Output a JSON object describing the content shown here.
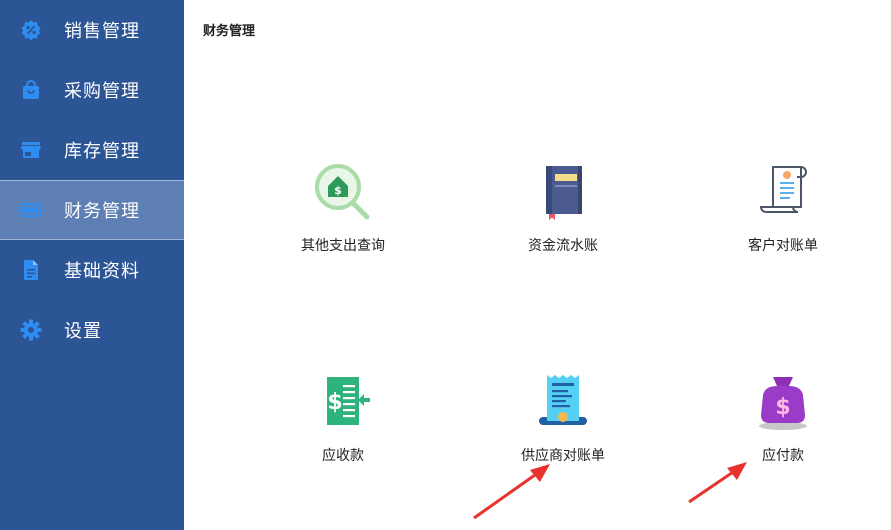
{
  "sidebar": {
    "items": [
      {
        "label": "销售管理",
        "icon": "percent-badge-icon"
      },
      {
        "label": "采购管理",
        "icon": "shopping-bag-icon"
      },
      {
        "label": "库存管理",
        "icon": "store-icon"
      },
      {
        "label": "财务管理",
        "icon": "money-icon",
        "active": true
      },
      {
        "label": "基础资料",
        "icon": "document-icon"
      },
      {
        "label": "设置",
        "icon": "gear-icon"
      }
    ],
    "background_color": "#2c5596",
    "active_color": "#5e7fb3",
    "icon_color": "#2f8cf0"
  },
  "main": {
    "title": "财务管理",
    "tiles": [
      {
        "label": "其他支出查询",
        "icon": "magnifier-house-money-icon"
      },
      {
        "label": "资金流水账",
        "icon": "ledger-book-icon"
      },
      {
        "label": "客户对账单",
        "icon": "scroll-document-icon"
      },
      {
        "label": "应收款",
        "icon": "bill-arrow-in-icon"
      },
      {
        "label": "供应商对账单",
        "icon": "receipt-icon"
      },
      {
        "label": "应付款",
        "icon": "money-bag-icon"
      }
    ]
  },
  "annotations": {
    "arrow_color": "#e8322d"
  }
}
